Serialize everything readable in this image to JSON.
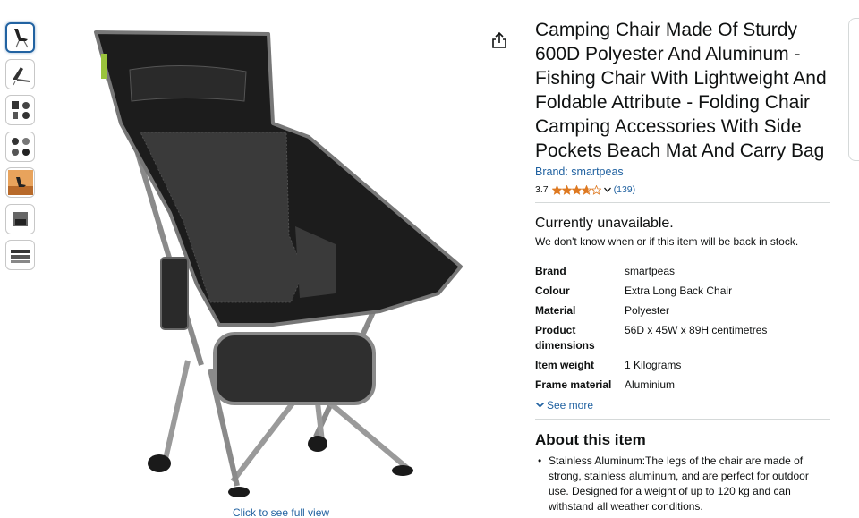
{
  "gallery": {
    "thumbnail_count": 7,
    "full_view_link": "Click to see full view"
  },
  "product": {
    "title": "Camping Chair Made Of Sturdy 600D Polyester And Aluminum - Fishing Chair With Lightweight And Foldable Attribute - Folding Chair Camping Accessories With Side Pockets Beach Mat And Carry Bag",
    "brand_link": "Brand: smartpeas",
    "rating_value": "3.7",
    "rating_stars": 3.7,
    "rating_count": "(139)",
    "availability": "Currently unavailable.",
    "availability_note": "We don't know when or if this item will be back in stock.",
    "specs": [
      {
        "label": "Brand",
        "value": "smartpeas"
      },
      {
        "label": "Colour",
        "value": "Extra Long Back Chair"
      },
      {
        "label": "Material",
        "value": "Polyester"
      },
      {
        "label": "Product dimensions",
        "value": "56D x 45W x 89H centimetres"
      },
      {
        "label": "Item weight",
        "value": "1 Kilograms"
      },
      {
        "label": "Frame material",
        "value": "Aluminium"
      }
    ],
    "see_more": "See more",
    "about_heading": "About this item",
    "about_bullets": [
      "Stainless Aluminum:The legs of the chair are made of strong, stainless aluminum, and are perfect for outdoor use. Designed for a weight of up to 120 kg and can withstand all weather conditions."
    ]
  },
  "colors": {
    "link": "#2162a1",
    "star": "#de7921",
    "text": "#0f1111"
  },
  "icons": {
    "share": "share-icon",
    "chevron": "chevron-down-icon",
    "star": "star-icon"
  }
}
